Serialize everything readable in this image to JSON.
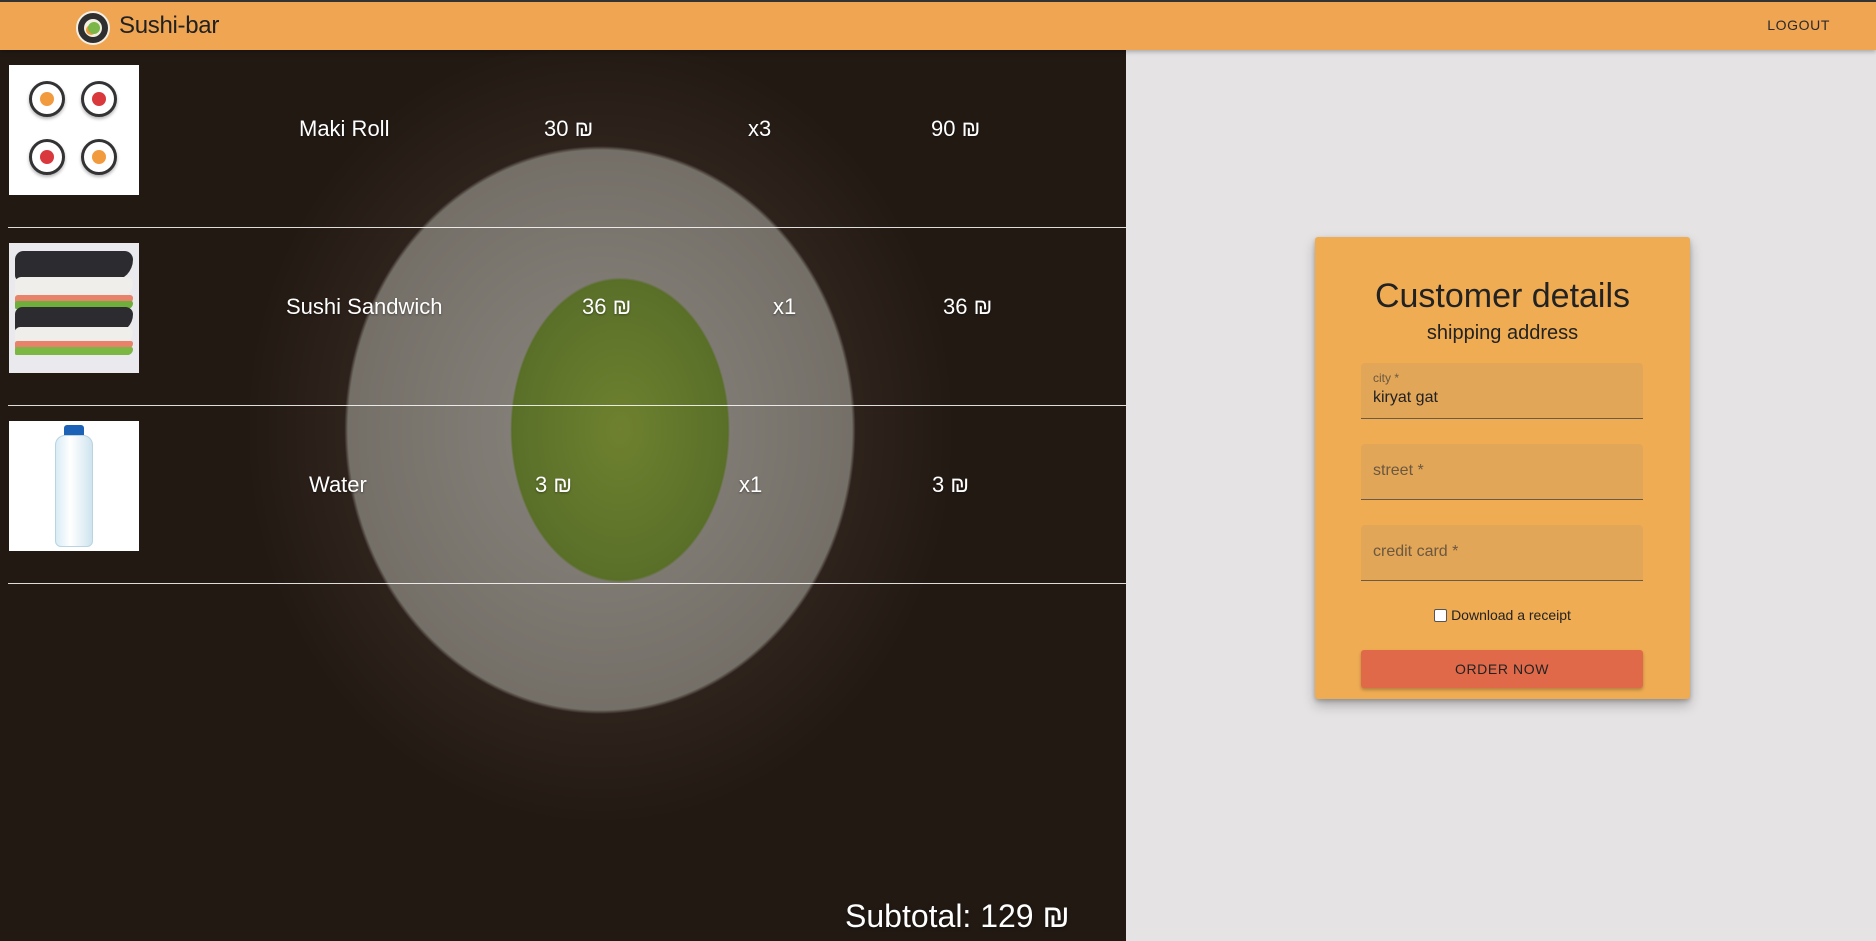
{
  "appbar": {
    "brand": "Sushi-bar",
    "logout_label": "LOGOUT"
  },
  "cart": {
    "items": [
      {
        "name": "Maki Roll",
        "price": "30 ₪",
        "qty": "x3",
        "total": "90 ₪"
      },
      {
        "name": "Sushi Sandwich",
        "price": "36 ₪",
        "qty": "x1",
        "total": "36 ₪"
      },
      {
        "name": "Water",
        "price": "3 ₪",
        "qty": "x1",
        "total": "3 ₪"
      }
    ],
    "subtotal": "Subtotal: 129 ₪"
  },
  "form": {
    "title": "Customer details",
    "subtitle": "shipping address",
    "city": {
      "label": "city *",
      "value": "kiryat gat"
    },
    "street": {
      "placeholder": "street *"
    },
    "credit_card": {
      "placeholder": "credit card *"
    },
    "receipt_label": "Download a receipt",
    "order_label": "ORDER NOW"
  },
  "colors": {
    "appbar": "#f0a552",
    "card": "#efac53",
    "button": "#e0694a"
  }
}
